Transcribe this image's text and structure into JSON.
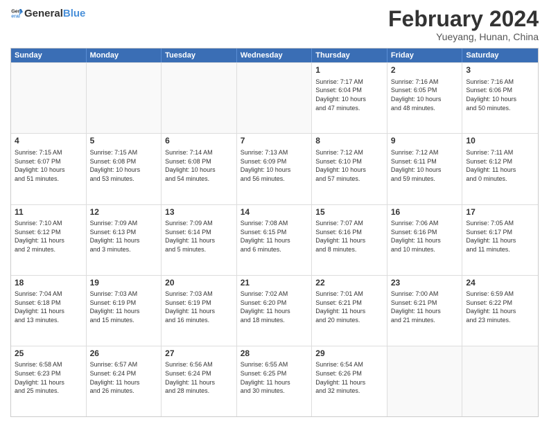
{
  "logo": {
    "text_general": "General",
    "text_blue": "Blue"
  },
  "header": {
    "month": "February 2024",
    "location": "Yueyang, Hunan, China"
  },
  "weekdays": [
    "Sunday",
    "Monday",
    "Tuesday",
    "Wednesday",
    "Thursday",
    "Friday",
    "Saturday"
  ],
  "rows": [
    [
      {
        "day": "",
        "info": "",
        "empty": true
      },
      {
        "day": "",
        "info": "",
        "empty": true
      },
      {
        "day": "",
        "info": "",
        "empty": true
      },
      {
        "day": "",
        "info": "",
        "empty": true
      },
      {
        "day": "1",
        "info": "Sunrise: 7:17 AM\nSunset: 6:04 PM\nDaylight: 10 hours\nand 47 minutes.",
        "empty": false
      },
      {
        "day": "2",
        "info": "Sunrise: 7:16 AM\nSunset: 6:05 PM\nDaylight: 10 hours\nand 48 minutes.",
        "empty": false
      },
      {
        "day": "3",
        "info": "Sunrise: 7:16 AM\nSunset: 6:06 PM\nDaylight: 10 hours\nand 50 minutes.",
        "empty": false
      }
    ],
    [
      {
        "day": "4",
        "info": "Sunrise: 7:15 AM\nSunset: 6:07 PM\nDaylight: 10 hours\nand 51 minutes.",
        "empty": false
      },
      {
        "day": "5",
        "info": "Sunrise: 7:15 AM\nSunset: 6:08 PM\nDaylight: 10 hours\nand 53 minutes.",
        "empty": false
      },
      {
        "day": "6",
        "info": "Sunrise: 7:14 AM\nSunset: 6:08 PM\nDaylight: 10 hours\nand 54 minutes.",
        "empty": false
      },
      {
        "day": "7",
        "info": "Sunrise: 7:13 AM\nSunset: 6:09 PM\nDaylight: 10 hours\nand 56 minutes.",
        "empty": false
      },
      {
        "day": "8",
        "info": "Sunrise: 7:12 AM\nSunset: 6:10 PM\nDaylight: 10 hours\nand 57 minutes.",
        "empty": false
      },
      {
        "day": "9",
        "info": "Sunrise: 7:12 AM\nSunset: 6:11 PM\nDaylight: 10 hours\nand 59 minutes.",
        "empty": false
      },
      {
        "day": "10",
        "info": "Sunrise: 7:11 AM\nSunset: 6:12 PM\nDaylight: 11 hours\nand 0 minutes.",
        "empty": false
      }
    ],
    [
      {
        "day": "11",
        "info": "Sunrise: 7:10 AM\nSunset: 6:12 PM\nDaylight: 11 hours\nand 2 minutes.",
        "empty": false
      },
      {
        "day": "12",
        "info": "Sunrise: 7:09 AM\nSunset: 6:13 PM\nDaylight: 11 hours\nand 3 minutes.",
        "empty": false
      },
      {
        "day": "13",
        "info": "Sunrise: 7:09 AM\nSunset: 6:14 PM\nDaylight: 11 hours\nand 5 minutes.",
        "empty": false
      },
      {
        "day": "14",
        "info": "Sunrise: 7:08 AM\nSunset: 6:15 PM\nDaylight: 11 hours\nand 6 minutes.",
        "empty": false
      },
      {
        "day": "15",
        "info": "Sunrise: 7:07 AM\nSunset: 6:16 PM\nDaylight: 11 hours\nand 8 minutes.",
        "empty": false
      },
      {
        "day": "16",
        "info": "Sunrise: 7:06 AM\nSunset: 6:16 PM\nDaylight: 11 hours\nand 10 minutes.",
        "empty": false
      },
      {
        "day": "17",
        "info": "Sunrise: 7:05 AM\nSunset: 6:17 PM\nDaylight: 11 hours\nand 11 minutes.",
        "empty": false
      }
    ],
    [
      {
        "day": "18",
        "info": "Sunrise: 7:04 AM\nSunset: 6:18 PM\nDaylight: 11 hours\nand 13 minutes.",
        "empty": false
      },
      {
        "day": "19",
        "info": "Sunrise: 7:03 AM\nSunset: 6:19 PM\nDaylight: 11 hours\nand 15 minutes.",
        "empty": false
      },
      {
        "day": "20",
        "info": "Sunrise: 7:03 AM\nSunset: 6:19 PM\nDaylight: 11 hours\nand 16 minutes.",
        "empty": false
      },
      {
        "day": "21",
        "info": "Sunrise: 7:02 AM\nSunset: 6:20 PM\nDaylight: 11 hours\nand 18 minutes.",
        "empty": false
      },
      {
        "day": "22",
        "info": "Sunrise: 7:01 AM\nSunset: 6:21 PM\nDaylight: 11 hours\nand 20 minutes.",
        "empty": false
      },
      {
        "day": "23",
        "info": "Sunrise: 7:00 AM\nSunset: 6:21 PM\nDaylight: 11 hours\nand 21 minutes.",
        "empty": false
      },
      {
        "day": "24",
        "info": "Sunrise: 6:59 AM\nSunset: 6:22 PM\nDaylight: 11 hours\nand 23 minutes.",
        "empty": false
      }
    ],
    [
      {
        "day": "25",
        "info": "Sunrise: 6:58 AM\nSunset: 6:23 PM\nDaylight: 11 hours\nand 25 minutes.",
        "empty": false
      },
      {
        "day": "26",
        "info": "Sunrise: 6:57 AM\nSunset: 6:24 PM\nDaylight: 11 hours\nand 26 minutes.",
        "empty": false
      },
      {
        "day": "27",
        "info": "Sunrise: 6:56 AM\nSunset: 6:24 PM\nDaylight: 11 hours\nand 28 minutes.",
        "empty": false
      },
      {
        "day": "28",
        "info": "Sunrise: 6:55 AM\nSunset: 6:25 PM\nDaylight: 11 hours\nand 30 minutes.",
        "empty": false
      },
      {
        "day": "29",
        "info": "Sunrise: 6:54 AM\nSunset: 6:26 PM\nDaylight: 11 hours\nand 32 minutes.",
        "empty": false
      },
      {
        "day": "",
        "info": "",
        "empty": true
      },
      {
        "day": "",
        "info": "",
        "empty": true
      }
    ]
  ]
}
